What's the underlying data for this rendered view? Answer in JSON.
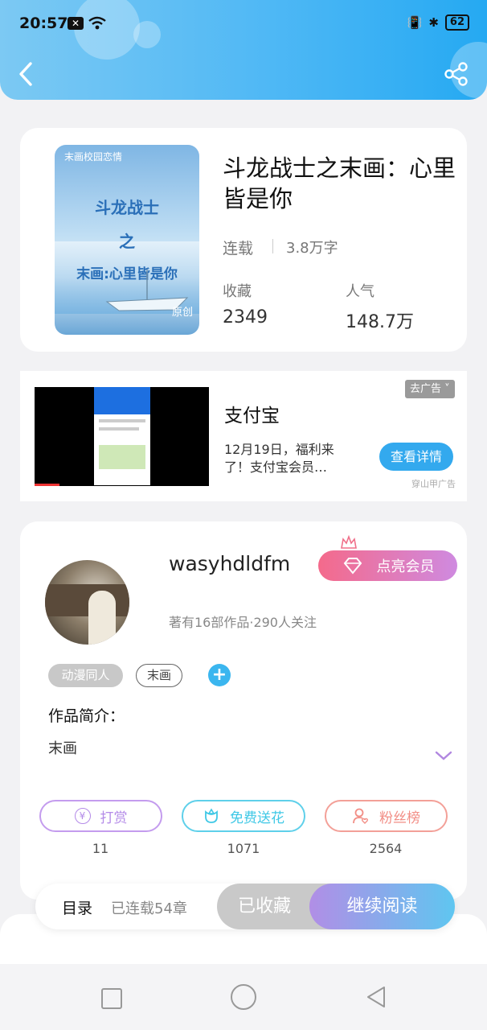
{
  "status_bar": {
    "time": "20:57",
    "battery": "62"
  },
  "book": {
    "cover_tag": "末画校园恋情",
    "cover_title_line1": "斗龙战士",
    "cover_title_line2": "之",
    "cover_title_line3": "末画:心里皆是你",
    "cover_badge": "原创",
    "title": "斗龙战士之末画：心里皆是你",
    "status": "连载",
    "word_count": "3.8万字",
    "favorites_label": "收藏",
    "favorites_value": "2349",
    "popularity_label": "人气",
    "popularity_value": "148.7万"
  },
  "ad": {
    "close_label": "去广告",
    "title": "支付宝",
    "text": "12月19日，福利来了！支付宝会员…",
    "cta_label": "查看详情",
    "source": "穿山甲广告"
  },
  "author": {
    "name": "wasyhdldfm",
    "vip_label": "点亮会员",
    "stats": "著有16部作品·290人关注",
    "tags": [
      "动漫同人",
      "末画"
    ],
    "intro_label": "作品简介：",
    "intro_text": "末画"
  },
  "actions": [
    {
      "label": "打赏",
      "count": "11"
    },
    {
      "label": "免费送花",
      "count": "1071"
    },
    {
      "label": "粉丝榜",
      "count": "2564"
    }
  ],
  "bottom_bar": {
    "catalog_label": "目录",
    "chapters_label": "已连载54章",
    "collected_label": "已收藏",
    "read_label": "继续阅读"
  },
  "colors": {
    "accent_blue": "#3bb3f0",
    "vip_pink": "#f46a8b",
    "reward_purple": "#b48be8",
    "flower_cyan": "#3fc8e6",
    "fans_red": "#f28e86"
  }
}
